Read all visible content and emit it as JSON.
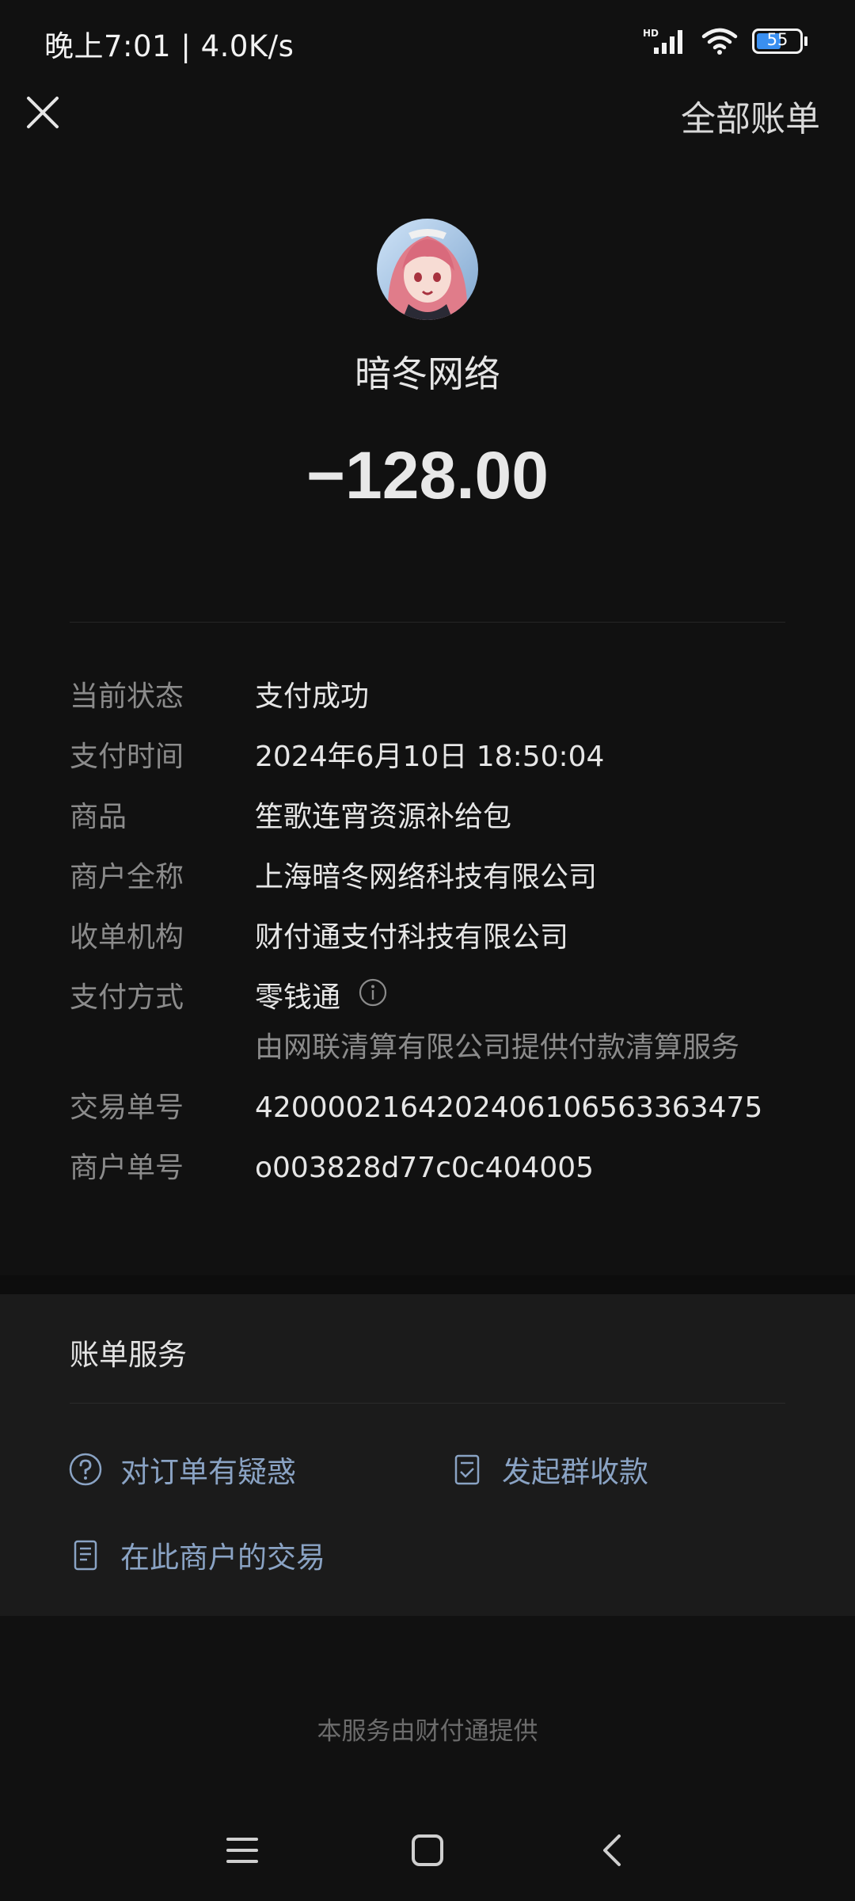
{
  "status_bar": {
    "time_speed": "晚上7:01 | 4.0K/s",
    "battery": "55"
  },
  "top_bar": {
    "all_bills": "全部账单"
  },
  "header": {
    "merchant_name": "暗冬网络",
    "amount": "−128.00"
  },
  "details": {
    "status": {
      "label": "当前状态",
      "value": "支付成功"
    },
    "pay_time": {
      "label": "支付时间",
      "value": "2024年6月10日 18:50:04"
    },
    "product": {
      "label": "商品",
      "value": "笙歌连宵资源补给包"
    },
    "merchant_full": {
      "label": "商户全称",
      "value": "上海暗冬网络科技有限公司"
    },
    "acquirer": {
      "label": "收单机构",
      "value": "财付通支付科技有限公司"
    },
    "pay_method": {
      "label": "支付方式",
      "value": "零钱通",
      "sub": "由网联清算有限公司提供付款清算服务"
    },
    "trade_no": {
      "label": "交易单号",
      "value": "4200002164202406106563363475"
    },
    "merchant_no": {
      "label": "商户单号",
      "value": "o003828d77c0c404005"
    }
  },
  "services": {
    "title": "账单服务",
    "question": "对订单有疑惑",
    "group_collect": "发起群收款",
    "merchant_trades": "在此商户的交易"
  },
  "footer": "本服务由财付通提供",
  "colors": {
    "background": "#111111",
    "card": "#1b1b1b",
    "link": "#8aa3c4",
    "muted": "#8b8b8b"
  }
}
